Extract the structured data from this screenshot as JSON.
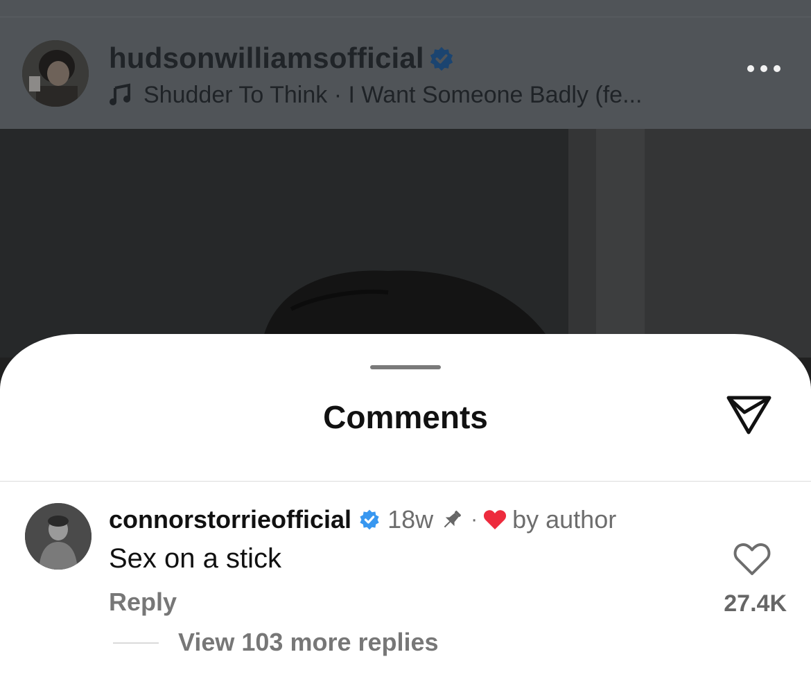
{
  "post_header": {
    "username": "hudsonwilliamsofficial",
    "verified_icon": "verified-badge-icon",
    "music_icon": "music-note-icon",
    "music_text": "Shudder To Think · I Want Someone Badly (fe...",
    "more_icon": "more-options-icon"
  },
  "sheet": {
    "title": "Comments",
    "share_icon": "send-icon"
  },
  "comment": {
    "username": "connorstorrieofficial",
    "time": "18w",
    "dot": "·",
    "liked_by_author": "by author",
    "text": "Sex on a stick",
    "reply_label": "Reply",
    "like_count": "27.4K",
    "view_replies": "View 103 more replies"
  },
  "colors": {
    "verified_blue": "#3897f0",
    "heart_red": "#ed2b3d",
    "overlay": "#505458"
  }
}
